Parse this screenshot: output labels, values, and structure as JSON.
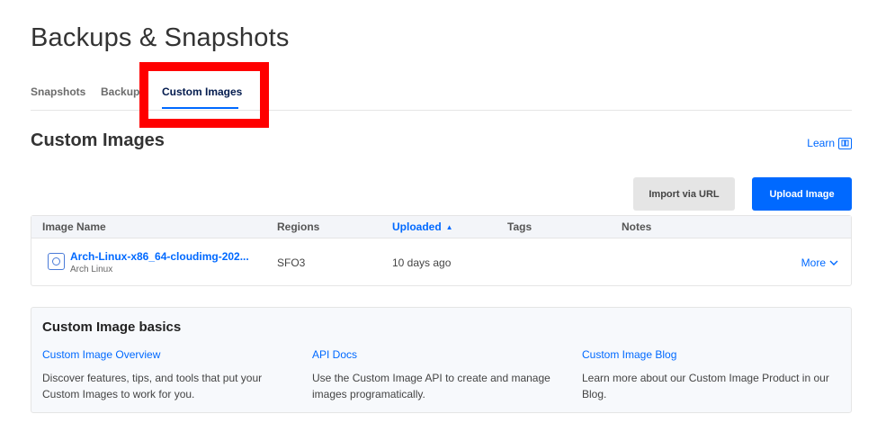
{
  "page": {
    "title": "Backups & Snapshots"
  },
  "tabs": [
    {
      "label": "Snapshots"
    },
    {
      "label": "Backups"
    },
    {
      "label": "Custom Images",
      "active": true
    }
  ],
  "section": {
    "title": "Custom Images",
    "learn_label": "Learn",
    "learn_icon": "book-icon"
  },
  "actions": {
    "import_label": "Import via URL",
    "upload_label": "Upload Image"
  },
  "table": {
    "headers": {
      "name": "Image Name",
      "regions": "Regions",
      "uploaded": "Uploaded",
      "tags": "Tags",
      "notes": "Notes"
    },
    "sort": {
      "column": "uploaded",
      "direction": "asc"
    },
    "rows": [
      {
        "name": "Arch-Linux-x86_64-cloudimg-202...",
        "distro": "Arch Linux",
        "region": "SFO3",
        "uploaded": "10 days ago",
        "tags": "",
        "notes": "",
        "more_label": "More"
      }
    ]
  },
  "basics": {
    "title": "Custom Image basics",
    "items": [
      {
        "link": "Custom Image Overview",
        "desc": "Discover features, tips, and tools that put your Custom Images to work for you."
      },
      {
        "link": "API Docs",
        "desc": "Use the Custom Image API to create and manage images programatically."
      },
      {
        "link": "Custom Image Blog",
        "desc": "Learn more about our Custom Image Product in our Blog."
      }
    ]
  },
  "colors": {
    "accent": "#0069ff",
    "highlight": "#ff0000"
  }
}
